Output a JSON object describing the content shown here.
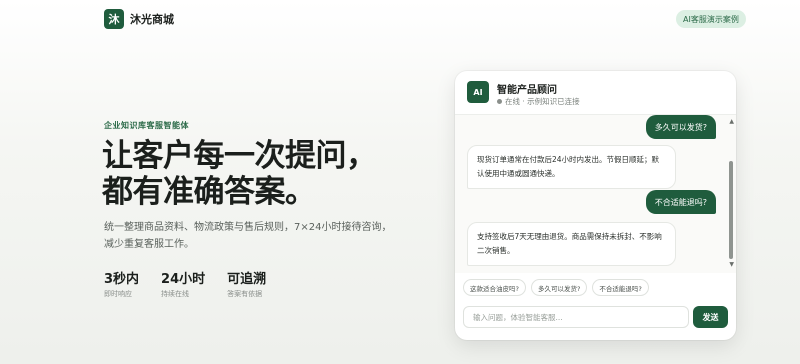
{
  "header": {
    "logo_glyph": "沐",
    "brand_name": "沐光商城",
    "demo_badge": "AI客服演示案例"
  },
  "hero": {
    "eyebrow": "企业知识库客服智能体",
    "title_line1": "让客户每一次提问，",
    "title_line2": "都有准确答案。",
    "description": "统一整理商品资料、物流政策与售后规则，7×24小时接待咨询，减少重复客服工作。",
    "stats": [
      {
        "value": "3秒内",
        "label": "即时响应"
      },
      {
        "value": "24小时",
        "label": "持续在线"
      },
      {
        "value": "可追溯",
        "label": "答案有依据"
      }
    ]
  },
  "chat": {
    "avatar_label": "AI",
    "agent_name": "智能产品顾问",
    "agent_status": "在线 · 示例知识已连接",
    "messages": [
      {
        "role": "user",
        "text": "多久可以发货?"
      },
      {
        "role": "bot",
        "text": "现货订单通常在付款后24小时内发出。节假日顺延；默认使用中通或圆通快递。"
      },
      {
        "role": "user",
        "text": "不合适能退吗?"
      },
      {
        "role": "bot",
        "text": "支持签收后7天无理由退货。商品需保持未拆封、不影响二次销售。"
      }
    ],
    "quick_questions": [
      "这款适合油皮吗?",
      "多久可以发货?",
      "不合适能退吗?"
    ],
    "input_placeholder": "输入问题，体验智能客服...",
    "send_label": "发送"
  },
  "colors": {
    "brand": "#1f5c3d",
    "badge_bg": "#dcefe3"
  }
}
